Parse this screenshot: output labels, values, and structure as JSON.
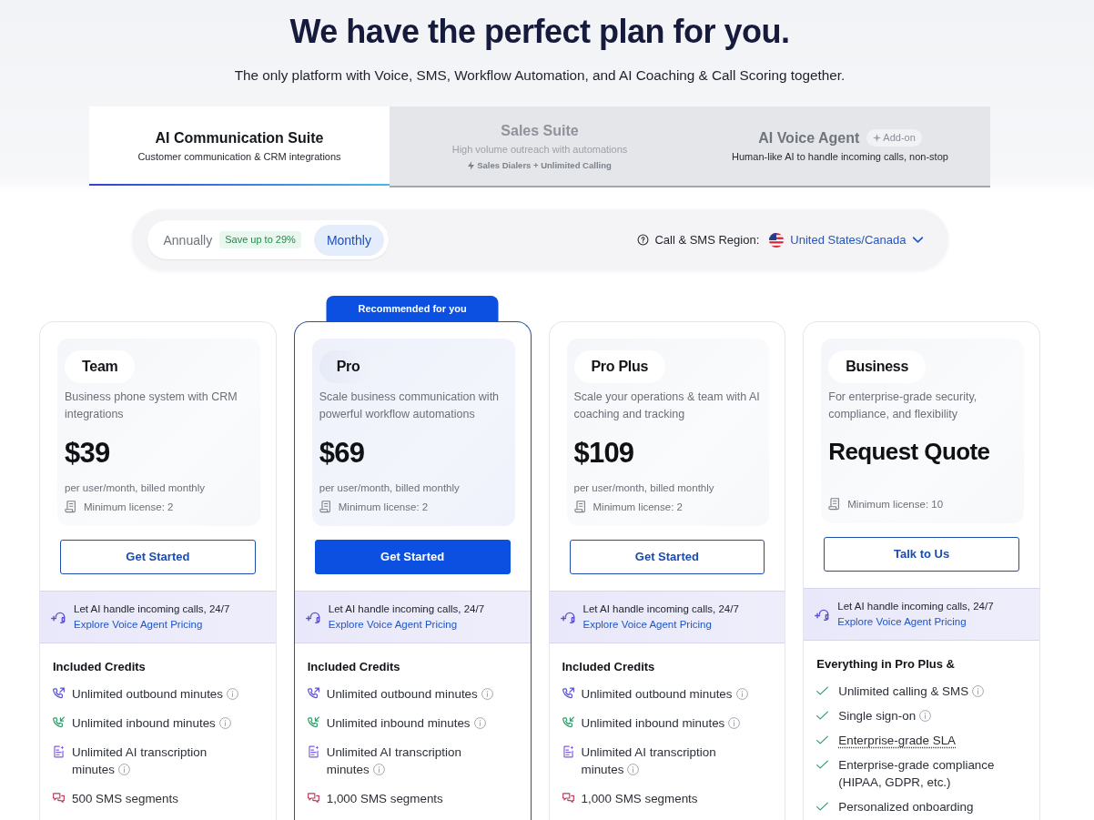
{
  "header": {
    "title": "We have the perfect plan for you.",
    "subtitle": "The only platform with Voice, SMS, Workflow Automation, and AI Coaching & Call Scoring together."
  },
  "suite_tabs": [
    {
      "title": "AI Communication Suite",
      "description": "Customer communication & CRM integrations",
      "selected": true,
      "disabled": false
    },
    {
      "title": "Sales Suite",
      "description": "High volume outreach with automations",
      "note": "Sales Dialers + Unlimited Calling",
      "selected": false,
      "disabled": true
    },
    {
      "title": "AI Voice Agent",
      "badge": "Add-on",
      "description": "Human-like AI to handle incoming calls, non-stop",
      "selected": false,
      "disabled": false
    }
  ],
  "billing_toggle": {
    "options": [
      {
        "label": "Annually",
        "badge": "Save up to 29%",
        "selected": false
      },
      {
        "label": "Monthly",
        "selected": true
      }
    ]
  },
  "region": {
    "label": "Call & SMS Region:",
    "value": "United States/Canada"
  },
  "plans": [
    {
      "name": "Team",
      "recommended": false,
      "description": "Business phone system with CRM integrations",
      "price": "$39",
      "billing": "per user/month, billed monthly",
      "minimum": "Minimum license: 2",
      "button": "Get Started",
      "promo": {
        "text": "Let AI handle incoming calls, 24/7",
        "link": "Explore Voice Agent Pricing"
      },
      "features_title": "Included Credits",
      "features": [
        {
          "kind": "outbound",
          "text": "Unlimited outbound minutes",
          "info": true
        },
        {
          "kind": "inbound",
          "text": "Unlimited inbound minutes",
          "info": true
        },
        {
          "kind": "transcription",
          "text": "Unlimited AI transcription minutes",
          "info": true
        },
        {
          "kind": "sms",
          "text": "500 SMS segments",
          "info": false
        }
      ]
    },
    {
      "name": "Pro",
      "recommended": true,
      "ribbon": "Recommended for you",
      "description": "Scale business communication with powerful workflow automations",
      "price": "$69",
      "billing": "per user/month, billed monthly",
      "minimum": "Minimum license: 2",
      "button": "Get Started",
      "promo": {
        "text": "Let AI handle incoming calls, 24/7",
        "link": "Explore Voice Agent Pricing"
      },
      "features_title": "Included Credits",
      "features": [
        {
          "kind": "outbound",
          "text": "Unlimited outbound minutes",
          "info": true
        },
        {
          "kind": "inbound",
          "text": "Unlimited inbound minutes",
          "info": true
        },
        {
          "kind": "transcription",
          "text": "Unlimited AI transcription minutes",
          "info": true
        },
        {
          "kind": "sms",
          "text": "1,000 SMS segments",
          "info": false
        }
      ]
    },
    {
      "name": "Pro Plus",
      "recommended": false,
      "description": "Scale your operations & team with AI coaching and tracking",
      "price": "$109",
      "billing": "per user/month, billed monthly",
      "minimum": "Minimum license: 2",
      "button": "Get Started",
      "promo": {
        "text": "Let AI handle incoming calls, 24/7",
        "link": "Explore Voice Agent Pricing"
      },
      "features_title": "Included Credits",
      "features": [
        {
          "kind": "outbound",
          "text": "Unlimited outbound minutes",
          "info": true
        },
        {
          "kind": "inbound",
          "text": "Unlimited inbound minutes",
          "info": true
        },
        {
          "kind": "transcription",
          "text": "Unlimited AI transcription minutes",
          "info": true
        },
        {
          "kind": "sms",
          "text": "1,000 SMS segments",
          "info": false
        }
      ]
    },
    {
      "name": "Business",
      "recommended": false,
      "description": "For enterprise-grade security, compliance, and flexibility",
      "price": "Request Quote",
      "minimum": "Minimum license: 10",
      "button": "Talk to Us",
      "promo": {
        "text": "Let AI handle incoming calls, 24/7",
        "link": "Explore Voice Agent Pricing"
      },
      "features_title": "Everything in Pro Plus &",
      "features": [
        {
          "kind": "check",
          "text": "Unlimited calling & SMS",
          "info": true,
          "underlined": false
        },
        {
          "kind": "check",
          "text": "Single sign-on",
          "info": true,
          "underlined": false
        },
        {
          "kind": "check",
          "text": "Enterprise-grade SLA",
          "info": false,
          "underlined": true
        },
        {
          "kind": "check",
          "text": "Enterprise-grade compliance (HIPAA, GDPR, etc.)",
          "info": false,
          "underlined": false
        },
        {
          "kind": "check",
          "text": "Personalized onboarding",
          "info": false,
          "underlined": false
        }
      ]
    }
  ]
}
